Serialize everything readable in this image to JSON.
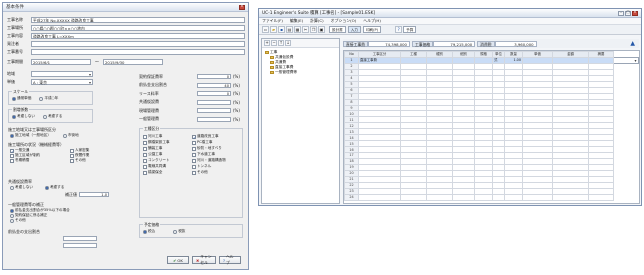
{
  "dialog": {
    "title": "基本条件",
    "top_fields": [
      {
        "label": "工事名称",
        "value": "平成27年 No.XXXXX 道路改良工事"
      },
      {
        "label": "工事場所",
        "value": "○○県○○郡○○町××○○地内"
      },
      {
        "label": "工事内容",
        "value": "道路改良工事 L=XXXm"
      },
      {
        "label": "発注者",
        "value": ""
      },
      {
        "label": "工事番号",
        "value": ""
      }
    ],
    "period": {
      "label": "工事期間",
      "start": "2015/6/1",
      "sep": "〜",
      "end": "2015/9/30"
    },
    "selects": [
      {
        "label": "地域",
        "value": ""
      },
      {
        "label": "単価",
        "value": "A : 東京"
      }
    ],
    "left_groups": [
      {
        "caption": "スケール",
        "options": [
          "通常単価",
          "平成○年"
        ],
        "checked": 0
      },
      {
        "caption": "割増係数",
        "options": [
          "考慮しない",
          "考慮する"
        ],
        "checked": 0
      }
    ],
    "section_head": "施工地域又は工事場所区分",
    "section_options": [
      "施工地域（一般地区）",
      "市街地"
    ],
    "class_head": "施工場所の状況（機械経費等）",
    "class_options": [
      "一般交通",
      "人家密集",
      "施工区域が制約",
      "夜間作業",
      "冬期積雪",
      "その他"
    ],
    "cost_head": "共通仮設費率",
    "cost_options": [
      "考慮しない",
      "考慮する"
    ],
    "ratio_label": "補正値",
    "ratio_value": "1.0",
    "misc_head": "一般管理費等の補正",
    "misc_options": [
      "前払金支出割合が35%以下の場合",
      "契約保証に係る補正",
      "その他"
    ],
    "adjust_head": "前払金の支出割合",
    "adjust_values": [
      "",
      ""
    ],
    "right_params": [
      {
        "label": "契約保証費率",
        "value": "0",
        "unit": "(%)"
      },
      {
        "label": "前払金支出割合",
        "value": "40",
        "unit": "(%)"
      },
      {
        "label": "リース料率",
        "value": "0",
        "unit": "(%)"
      },
      {
        "label": "共通仮設費",
        "value": "",
        "unit": "(%)"
      },
      {
        "label": "現場管理費",
        "value": "",
        "unit": "(%)"
      },
      {
        "label": "一般管理費",
        "value": "",
        "unit": "(%)"
      }
    ],
    "right_group_caption": "工種区分",
    "right_group_items": [
      "河川工事",
      "道路改良工事",
      "鋼橋架設工事",
      "PC橋工事",
      "舗装工事",
      "砂防・地すべり",
      "公園工事",
      "下水道工事",
      "コンクリート",
      "河川・道路構造物",
      "電線共同溝",
      "トンネル",
      "橋梁保全",
      "その他"
    ],
    "right_bottom_caption": "予定価格",
    "right_bottom_options": [
      "税込",
      "税抜"
    ],
    "buttons": {
      "ok": "OK",
      "cancel": "キャンセル",
      "help": "ヘルプ"
    }
  },
  "main": {
    "title": "UC-1 Engineer's Suite 積算 [工事名] - [Sample01.ESK]",
    "menu": [
      "ファイル(F)",
      "編集(E)",
      "計算(C)",
      "オプション(O)",
      "ヘルプ(H)"
    ],
    "toolbar_boxes": [
      "設計書",
      "入力",
      "印刷(P)",
      "予算"
    ],
    "tree_title": "工事",
    "tree": [
      "共通仮設費",
      "共通費",
      "直接工事費",
      "一般管理費等"
    ],
    "summary": [
      {
        "label": "直接工事費",
        "value": "74,398,000"
      },
      {
        "label": "工事価格",
        "value": "79,215,000"
      },
      {
        "label": "消費税",
        "value": "3,960,000"
      }
    ],
    "columns": [
      "No",
      "工事区分",
      "工種",
      "種別",
      "細別",
      "規格",
      "単位",
      "数量",
      "単価",
      "金額",
      "摘要"
    ],
    "rows": [
      [
        "1",
        "直接工事費",
        "",
        "",
        "",
        "",
        "式",
        "1.00",
        "",
        "",
        ""
      ],
      [
        "2",
        "",
        "",
        "",
        "",
        "",
        "",
        "",
        "",
        "",
        ""
      ],
      [
        "3",
        "",
        "",
        "",
        "",
        "",
        "",
        "",
        "",
        "",
        ""
      ],
      [
        "4",
        "",
        "",
        "",
        "",
        "",
        "",
        "",
        "",
        "",
        ""
      ],
      [
        "5",
        "",
        "",
        "",
        "",
        "",
        "",
        "",
        "",
        "",
        ""
      ],
      [
        "6",
        "",
        "",
        "",
        "",
        "",
        "",
        "",
        "",
        "",
        ""
      ],
      [
        "7",
        "",
        "",
        "",
        "",
        "",
        "",
        "",
        "",
        "",
        ""
      ],
      [
        "8",
        "",
        "",
        "",
        "",
        "",
        "",
        "",
        "",
        "",
        ""
      ],
      [
        "9",
        "",
        "",
        "",
        "",
        "",
        "",
        "",
        "",
        "",
        ""
      ],
      [
        "10",
        "",
        "",
        "",
        "",
        "",
        "",
        "",
        "",
        "",
        ""
      ],
      [
        "11",
        "",
        "",
        "",
        "",
        "",
        "",
        "",
        "",
        "",
        ""
      ],
      [
        "12",
        "",
        "",
        "",
        "",
        "",
        "",
        "",
        "",
        "",
        ""
      ],
      [
        "13",
        "",
        "",
        "",
        "",
        "",
        "",
        "",
        "",
        "",
        ""
      ],
      [
        "14",
        "",
        "",
        "",
        "",
        "",
        "",
        "",
        "",
        "",
        ""
      ],
      [
        "15",
        "",
        "",
        "",
        "",
        "",
        "",
        "",
        "",
        "",
        ""
      ],
      [
        "16",
        "",
        "",
        "",
        "",
        "",
        "",
        "",
        "",
        "",
        ""
      ],
      [
        "17",
        "",
        "",
        "",
        "",
        "",
        "",
        "",
        "",
        "",
        ""
      ],
      [
        "18",
        "",
        "",
        "",
        "",
        "",
        "",
        "",
        "",
        "",
        ""
      ],
      [
        "19",
        "",
        "",
        "",
        "",
        "",
        "",
        "",
        "",
        "",
        ""
      ],
      [
        "20",
        "",
        "",
        "",
        "",
        "",
        "",
        "",
        "",
        "",
        ""
      ],
      [
        "21",
        "",
        "",
        "",
        "",
        "",
        "",
        "",
        "",
        "",
        ""
      ],
      [
        "22",
        "",
        "",
        "",
        "",
        "",
        "",
        "",
        "",
        "",
        ""
      ],
      [
        "23",
        "",
        "",
        "",
        "",
        "",
        "",
        "",
        "",
        "",
        ""
      ],
      [
        "24",
        "",
        "",
        "",
        "",
        "",
        "",
        "",
        "",
        "",
        ""
      ]
    ],
    "selected_row": 0
  }
}
